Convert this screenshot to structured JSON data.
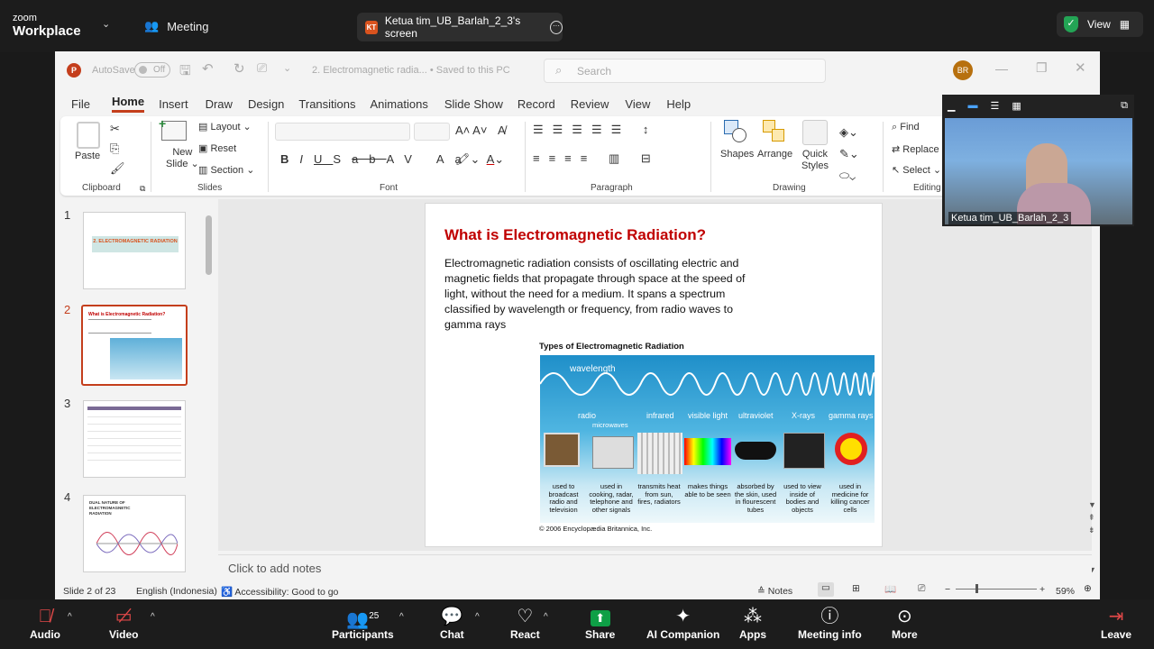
{
  "zoom": {
    "logo_line1": "zoom",
    "logo_line2": "Workplace",
    "meeting_label": "Meeting",
    "share_initials": "KT",
    "share_title": "Ketua tim_UB_Barlah_2_3's screen",
    "view_label": "View",
    "bottom": {
      "audio": "Audio",
      "video": "Video",
      "participants": "Participants",
      "participants_count": "25",
      "chat": "Chat",
      "react": "React",
      "share": "Share",
      "ai_companion": "AI Companion",
      "apps": "Apps",
      "meeting_info": "Meeting info",
      "more": "More",
      "leave": "Leave"
    },
    "video_tile_name": "Ketua tim_UB_Barlah_2_3"
  },
  "ppt": {
    "autosave_label": "AutoSave",
    "autosave_state": "Off",
    "doc_title": "2. Electromagnetic radia... • Saved to this PC",
    "search_placeholder": "Search",
    "user_initials": "BR",
    "tabs": [
      "File",
      "Home",
      "Insert",
      "Draw",
      "Design",
      "Transitions",
      "Animations",
      "Slide Show",
      "Record",
      "Review",
      "View",
      "Help"
    ],
    "active_tab": "Home",
    "ribbon": {
      "paste": "Paste",
      "clipboard": "Clipboard",
      "new_slide": "New",
      "new_slide2": "Slide",
      "layout": "Layout",
      "reset": "Reset",
      "section": "Section",
      "slides": "Slides",
      "font": "Font",
      "paragraph": "Paragraph",
      "shapes": "Shapes",
      "arrange": "Arrange",
      "quick_styles": "Quick",
      "quick_styles2": "Styles",
      "drawing": "Drawing",
      "find": "Find",
      "replace": "Replace",
      "select": "Select",
      "editing": "Editing"
    },
    "thumbnails": [
      {
        "num": "1",
        "title": "2. ELECTROMAGNETIC RADIATION"
      },
      {
        "num": "2",
        "title": "What is Electromagnetic Radiation?"
      },
      {
        "num": "3",
        "title": ""
      },
      {
        "num": "4",
        "title": "DUAL NATURE OF ELECTROMAGNETIC RADIATION"
      }
    ],
    "slide": {
      "title": "What is Electromagnetic Radiation?",
      "body": "Electromagnetic radiation consists of oscillating electric and magnetic fields that propagate through space at the speed of light, without the need for a medium. It spans a spectrum classified by wavelength or frequency, from radio waves to gamma rays",
      "figure_title": "Types of Electromagnetic Radiation",
      "wavelength_label": "wavelength",
      "bands": [
        "radio",
        "microwaves",
        "infrared",
        "visible light",
        "ultraviolet",
        "X-rays",
        "gamma rays"
      ],
      "uses": [
        "used to broadcast radio and television",
        "used in cooking, radar, telephone and other signals",
        "transmits heat from sun, fires, radiators",
        "makes things able to be seen",
        "absorbed by the skin, used in flourescent tubes",
        "used to view inside of bodies and objects",
        "used in medicine for killing cancer cells"
      ],
      "credit": "© 2006 Encyclopædia Britannica, Inc."
    },
    "notes_placeholder": "Click to add notes",
    "status": {
      "slide_of": "Slide 2 of 23",
      "language": "English (Indonesia)",
      "accessibility": "Accessibility: Good to go",
      "notes": "Notes",
      "zoom": "59%"
    }
  },
  "colors": {
    "title_red": "#c00000",
    "ppt_accent": "#c43e1c",
    "share_green": "#0e9f46"
  }
}
